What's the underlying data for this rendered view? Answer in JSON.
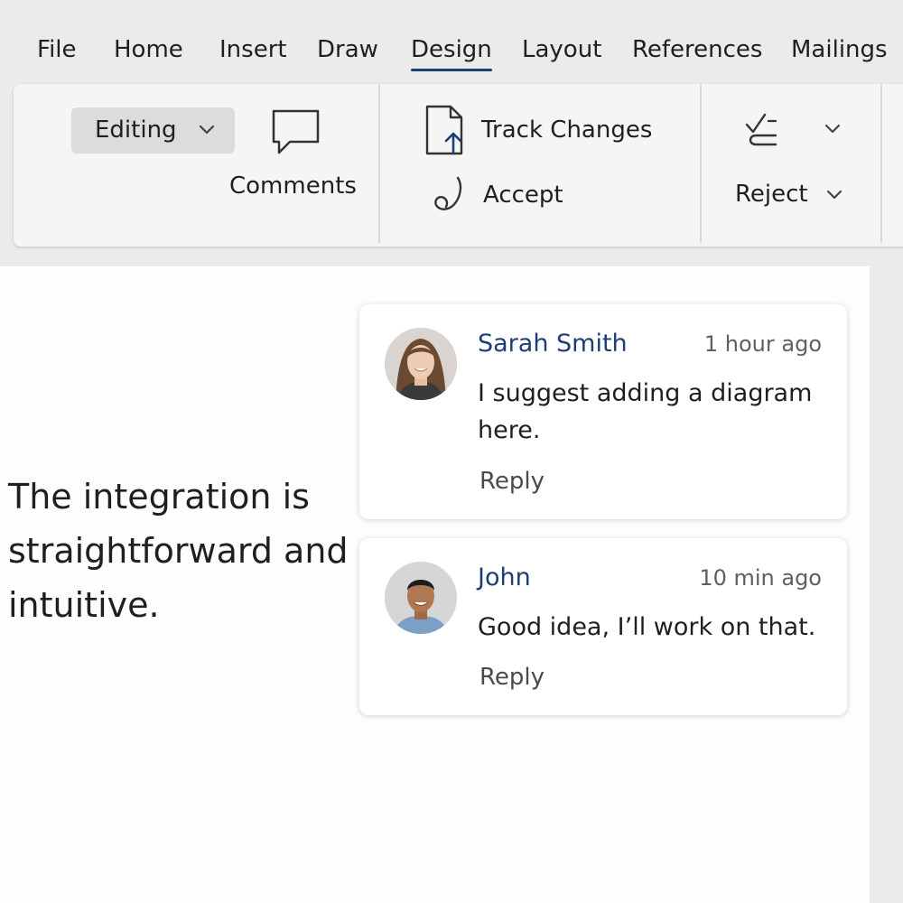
{
  "menu": {
    "items": [
      "File",
      "Home",
      "Insert",
      "Draw",
      "Design",
      "Layout",
      "References",
      "Mailings"
    ],
    "active": "Design"
  },
  "ribbon": {
    "editing_label": "Editing",
    "comments_label": "Comments",
    "track_changes_label": "Track Changes",
    "accept_label": "Accept",
    "reject_label": "Reject"
  },
  "document": {
    "text": "The integration is straightforward and intuitive."
  },
  "comments": [
    {
      "author": "Sarah Smith",
      "time": "1 hour ago",
      "text": "I suggest adding a diagram here.",
      "reply_label": "Reply"
    },
    {
      "author": "John",
      "time": "10 min ago",
      "text": "Good idea, I’ll work on that.",
      "reply_label": "Reply"
    }
  ],
  "colors": {
    "accent": "#1e3f74",
    "ribbon_bg": "#f5f5f5",
    "app_bg": "#ebebeb"
  },
  "icons": {
    "editing": "chevron-down-icon",
    "comments": "comment-bubble-icon",
    "track_changes": "document-arrow-icon",
    "accept": "accept-squiggle-icon",
    "reject": "reject-check-icon"
  }
}
